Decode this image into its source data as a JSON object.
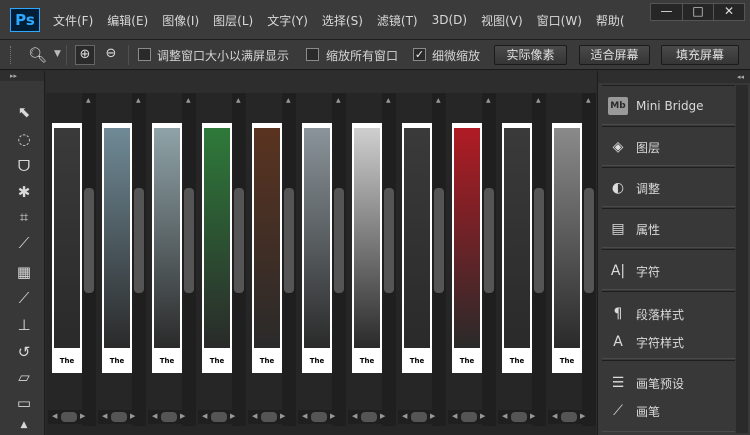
{
  "app": {
    "logo": "Ps",
    "menu": [
      "文件(F)",
      "编辑(E)",
      "图像(I)",
      "图层(L)",
      "文字(Y)",
      "选择(S)",
      "滤镜(T)",
      "3D(D)",
      "视图(V)",
      "窗口(W)",
      "帮助("
    ],
    "window_controls": {
      "minimize": "—",
      "restore": "□",
      "close": "✕"
    }
  },
  "options": {
    "resize_windows": {
      "label": "调整窗口大小以满屏显示",
      "checked": false
    },
    "zoom_all": {
      "label": "缩放所有窗口",
      "checked": false
    },
    "scrubby": {
      "label": "细微缩放",
      "checked": true
    },
    "actual_pixels": "实际像素",
    "fit_screen": "适合屏幕",
    "fill_screen": "填充屏幕"
  },
  "documents": [
    {
      "title": "The",
      "fill": "#3a3a3a"
    },
    {
      "title": "The",
      "fill": "#6f8a96"
    },
    {
      "title": "The",
      "fill": "#8fa3a8"
    },
    {
      "title": "The",
      "fill": "#2e7a3a"
    },
    {
      "title": "The",
      "fill": "#5a3320"
    },
    {
      "title": "The",
      "fill": "#8a949a"
    },
    {
      "title": "The",
      "fill": "#cfcfcf"
    },
    {
      "title": "The",
      "fill": "#3a3a3a"
    },
    {
      "title": "The",
      "fill": "#b01b24"
    },
    {
      "title": "The",
      "fill": "#3a3a3a"
    },
    {
      "title": "The",
      "fill": "#8a8a8a"
    }
  ],
  "panels": {
    "mini_bridge": {
      "icon": "Mb",
      "label": "Mini Bridge"
    },
    "layers": {
      "label": "图层"
    },
    "adjustments": {
      "label": "调整"
    },
    "properties": {
      "label": "属性"
    },
    "character": {
      "label": "字符"
    },
    "paragraph_styles": {
      "label": "段落样式"
    },
    "character_styles": {
      "label": "字符样式"
    },
    "brush_presets": {
      "label": "画笔预设"
    },
    "brush": {
      "label": "画笔"
    }
  }
}
